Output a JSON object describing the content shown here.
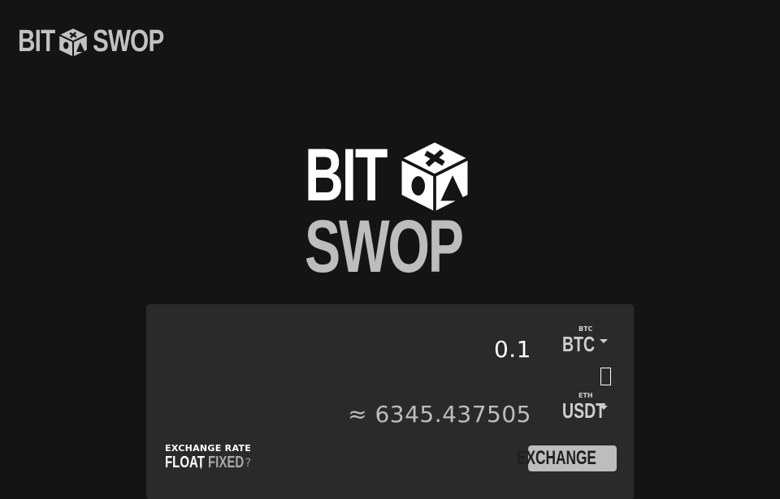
{
  "header": {
    "logo_word_1": "BIT",
    "logo_word_2": "SWOP"
  },
  "hero": {
    "logo_word_1": "BIT",
    "logo_word_2": "SWOP"
  },
  "exchange": {
    "from_amount": "0.1",
    "from_network": "BTC",
    "from_currency": "BTC",
    "to_amount": "≈ 6345.437505",
    "to_network": "ETH",
    "to_currency": "USDT",
    "rate_label": "EXCHANGE RATE",
    "rate_float": "FLOAT",
    "rate_separator": "|",
    "rate_fixed": "FIXED",
    "rate_help": "?",
    "submit_label": "EXCHANGE",
    "swap_icon": "swap-icon"
  },
  "colors": {
    "background": "#141414",
    "panel": "#2a2a2a",
    "accent_gray": "#bdbdbd"
  }
}
